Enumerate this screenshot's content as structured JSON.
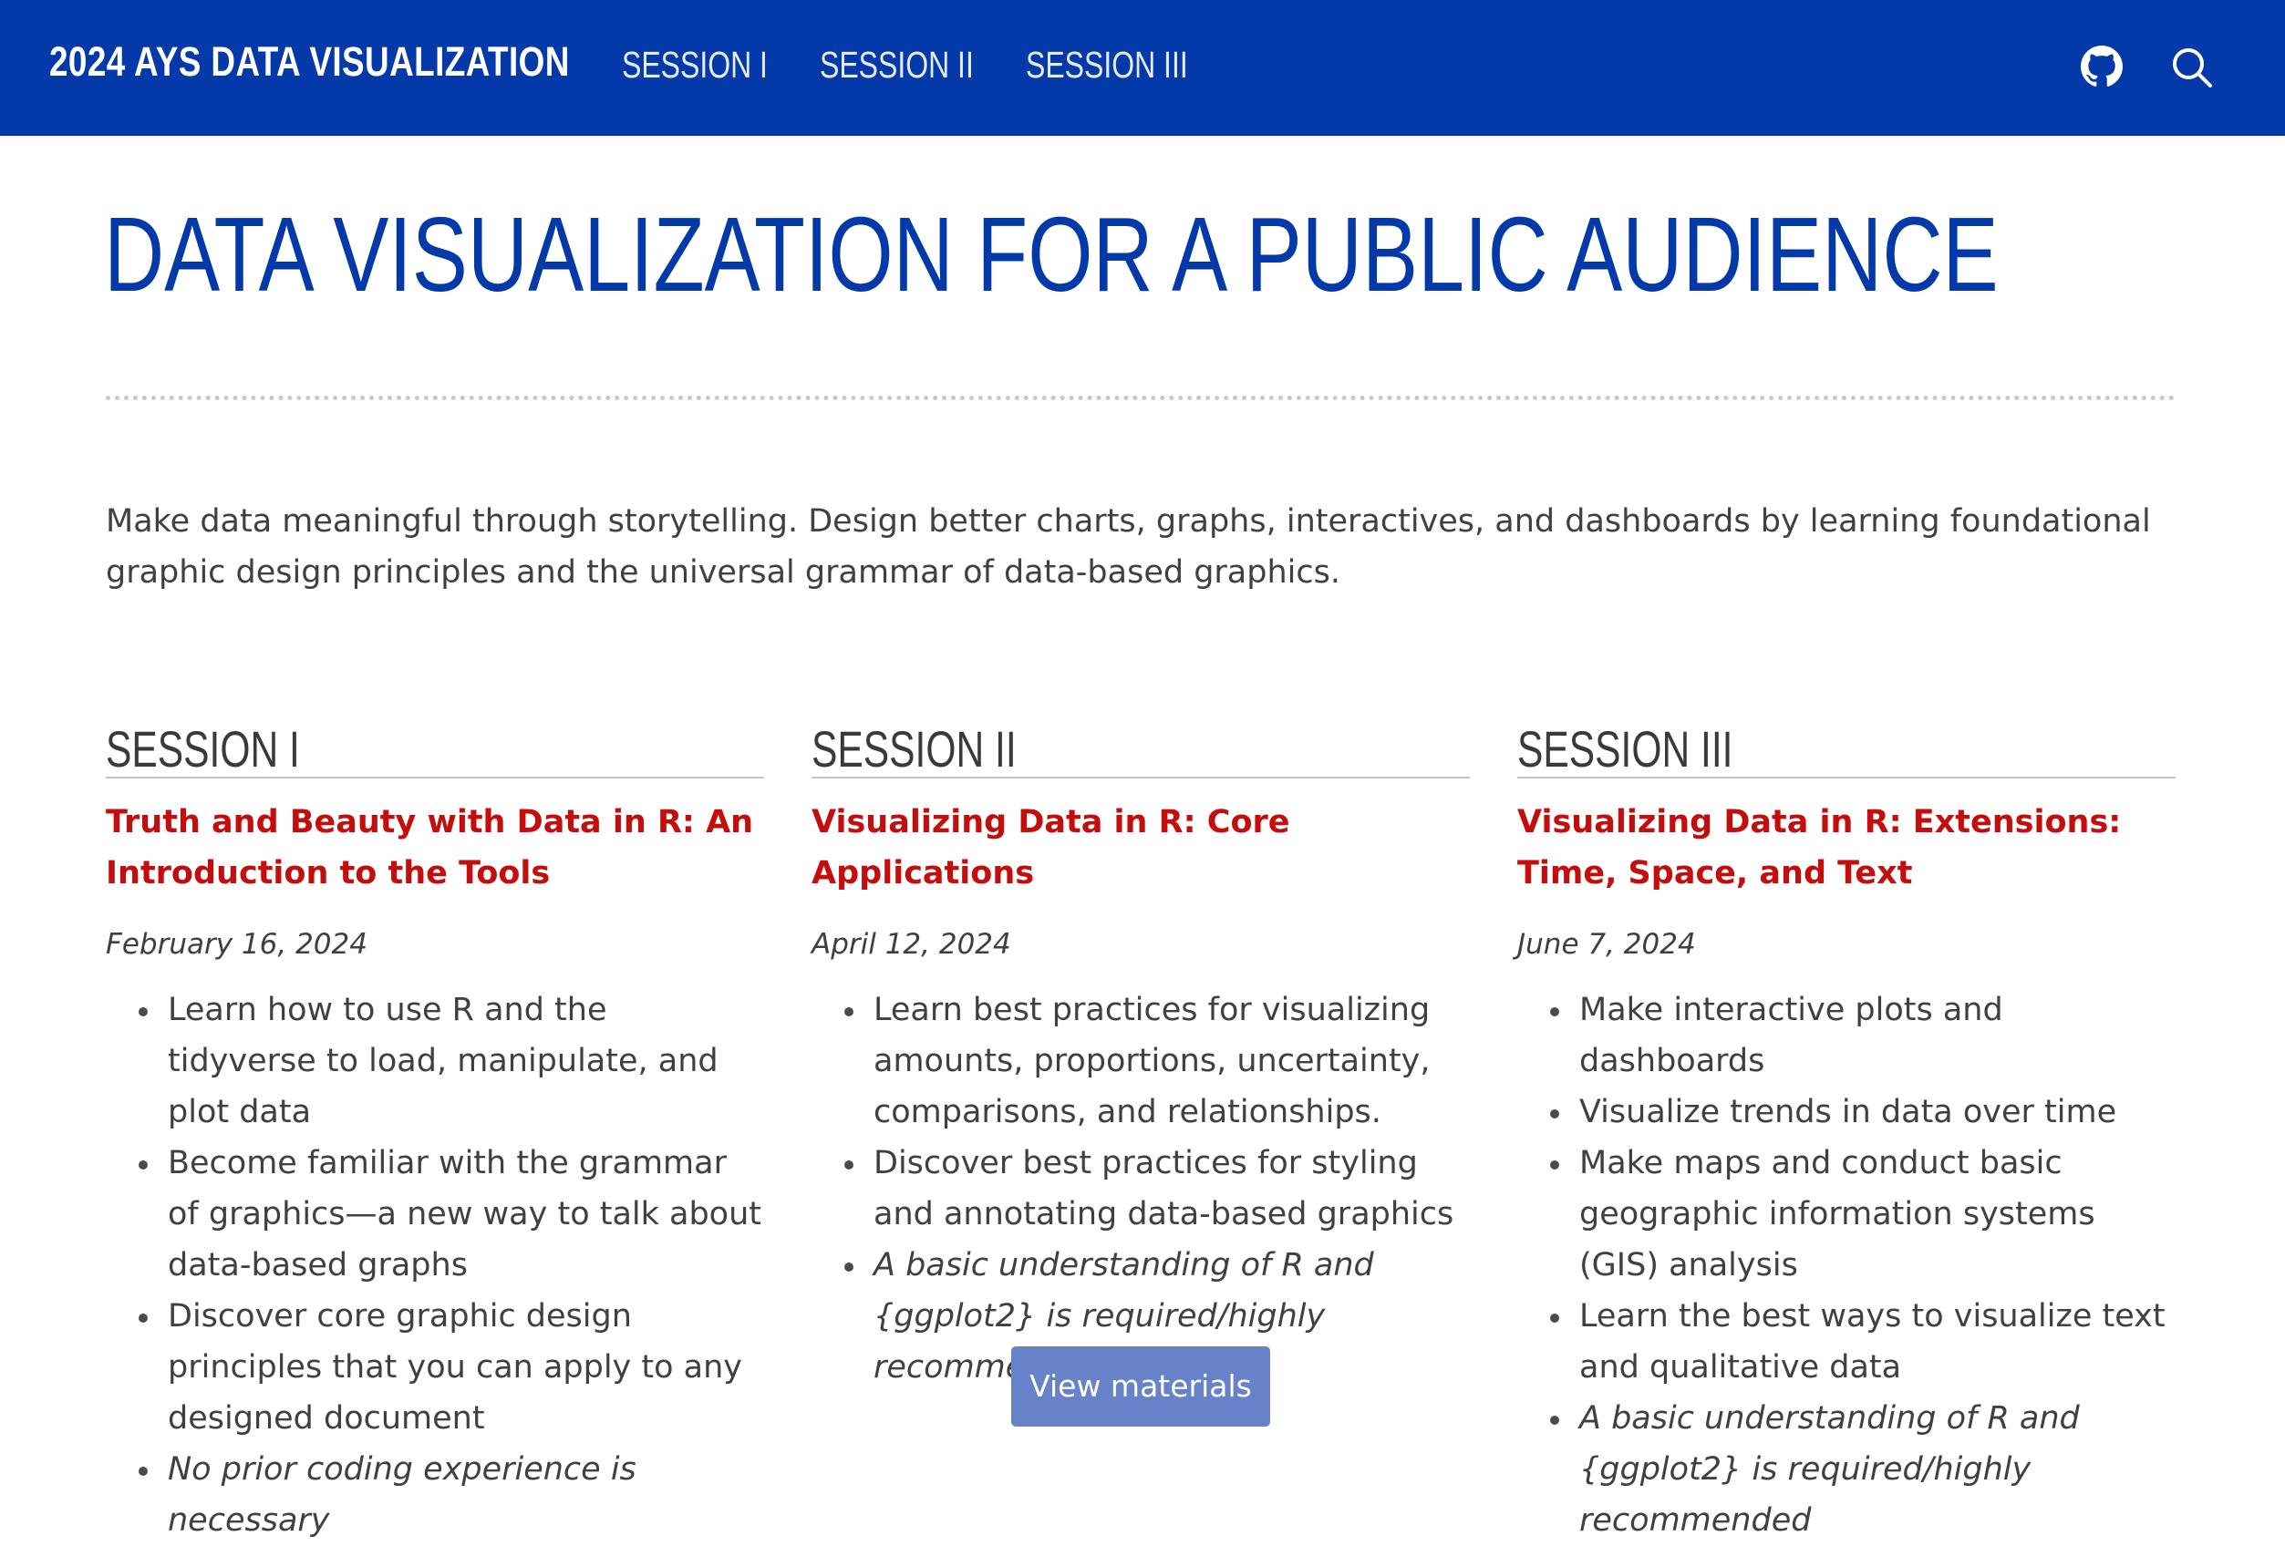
{
  "navbar": {
    "brand": "2024 AYS DATA VISUALIZATION",
    "links": [
      "SESSION I",
      "SESSION II",
      "SESSION III"
    ],
    "icons": [
      "github-icon",
      "search-icon"
    ]
  },
  "page": {
    "title": "DATA VISUALIZATION FOR A PUBLIC AUDIENCE",
    "intro": "Make data meaningful through storytelling. Design better charts, graphs, interactives, and dashboards by learning foundational graphic design principles and the universal grammar of data-based graphics."
  },
  "sessions": [
    {
      "heading": "SESSION I",
      "title": "Truth and Beauty with Data in R: An Introduction to the Tools",
      "date": "February 16, 2024",
      "bullets": [
        "Learn how to use R and the tidyverse to load, manipulate, and plot data",
        "Become familiar with the grammar of graphics—a new way to talk about data-based graphs",
        "Discover core graphic design principles that you can apply to any designed document"
      ],
      "note": "No prior coding experience is necessary"
    },
    {
      "heading": "SESSION II",
      "title": "Visualizing Data in R: Core Applications",
      "date": "April 12, 2024",
      "bullets": [
        "Learn best practices for visualizing amounts, proportions, uncertainty, comparisons, and relationships.",
        "Discover best practices for styling and annotating data-based graphics"
      ],
      "note": "A basic understanding of R and {ggplot2} is required/highly recommended",
      "button": "View materials"
    },
    {
      "heading": "SESSION III",
      "title": "Visualizing Data in R: Extensions: Time, Space, and Text",
      "date": "June 7, 2024",
      "bullets": [
        "Make interactive plots and dashboards",
        "Visualize trends in data over time",
        "Make maps and conduct basic geographic information systems (GIS) analysis",
        "Learn the best ways to visualize text and qualitative data"
      ],
      "note": "A basic understanding of R and {ggplot2} is required/highly recommended"
    }
  ],
  "colors": {
    "navbar_bg": "#0339a8",
    "title": "#0339a8",
    "session_link": "#c40d0d",
    "button_bg": "#6782c8"
  }
}
